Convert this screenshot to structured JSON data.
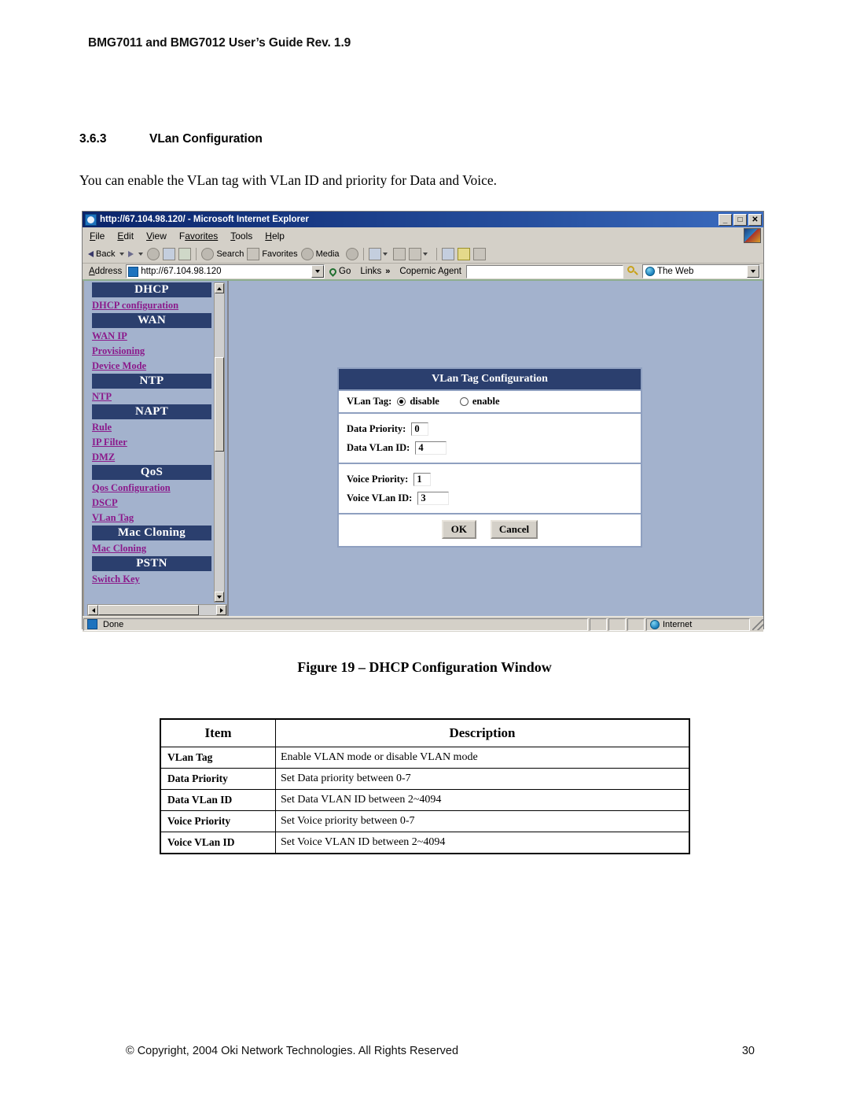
{
  "document": {
    "header": "BMG7011 and BMG7012 User’s Guide Rev. 1.9",
    "section_number": "3.6.3",
    "section_title": "VLan Configuration",
    "intro_paragraph": "You can enable the VLan tag with VLan ID and priority for Data and Voice.",
    "figure_caption": "Figure 19 – DHCP Configuration Window",
    "footer_copyright": "© Copyright, 2004 Oki Network Technologies. All Rights Reserved",
    "page_number": "30"
  },
  "browser": {
    "title": "http://67.104.98.120/ - Microsoft Internet Explorer",
    "window_buttons": {
      "minimize": "_",
      "maximize": "□",
      "close": "✕"
    },
    "menu": [
      {
        "label": "File",
        "accel": "F",
        "rest": "ile"
      },
      {
        "label": "Edit",
        "accel": "E",
        "rest": "dit"
      },
      {
        "label": "View",
        "accel": "V",
        "rest": "iew"
      },
      {
        "label": "Favorites",
        "accel": "F",
        "rest": "avorites"
      },
      {
        "label": "Tools",
        "accel": "T",
        "rest": "ools"
      },
      {
        "label": "Help",
        "accel": "H",
        "rest": "elp"
      }
    ],
    "toolbar": {
      "back": "Back",
      "search": "Search",
      "favorites": "Favorites",
      "media": "Media"
    },
    "address": {
      "label_accel": "A",
      "label_rest": "ddress",
      "value": "http://67.104.98.120",
      "go": "Go",
      "links": "Links",
      "links_chevron": "»",
      "copernic_label": "Copernic Agent",
      "copernic_value": "",
      "web_scope": "The Web"
    },
    "status": {
      "message": "Done",
      "zone": "Internet"
    }
  },
  "nav": {
    "groups": [
      {
        "header": "DHCP",
        "links": [
          "DHCP configuration"
        ]
      },
      {
        "header": "WAN",
        "links": [
          "WAN IP",
          "Provisioning",
          "Device Mode"
        ]
      },
      {
        "header": "NTP",
        "links": [
          "NTP"
        ]
      },
      {
        "header": "NAPT",
        "links": [
          "Rule",
          "IP Filter",
          "DMZ"
        ]
      },
      {
        "header": "QoS",
        "links": [
          "Qos Configuration",
          "DSCP",
          "VLan Tag"
        ]
      },
      {
        "header": "Mac Cloning",
        "links": [
          "Mac Cloning"
        ]
      },
      {
        "header": "PSTN",
        "links": [
          "Switch Key"
        ]
      }
    ]
  },
  "form": {
    "title": "VLan Tag Configuration",
    "vlan_tag_label": "VLan Tag:",
    "radio_disable": "disable",
    "radio_enable": "enable",
    "radio_selected": "disable",
    "data_priority_label": "Data Priority:",
    "data_priority_value": "0",
    "data_vlan_id_label": "Data VLan ID:",
    "data_vlan_id_value": "4",
    "voice_priority_label": "Voice Priority:",
    "voice_priority_value": "1",
    "voice_vlan_id_label": "Voice VLan ID:",
    "voice_vlan_id_value": "3",
    "ok_label": "OK",
    "cancel_label": "Cancel"
  },
  "table": {
    "headers": [
      "Item",
      "Description"
    ],
    "rows": [
      {
        "item": "VLan Tag",
        "desc": "Enable VLAN mode or disable VLAN mode"
      },
      {
        "item": "Data Priority",
        "desc": "Set Data priority between 0-7"
      },
      {
        "item": "Data VLan ID",
        "desc": "Set Data VLAN ID between 2~4094"
      },
      {
        "item": "Voice Priority",
        "desc": "Set Voice priority between 0-7"
      },
      {
        "item": "Voice VLan ID",
        "desc": "Set Voice VLAN ID between 2~4094"
      }
    ]
  },
  "colors": {
    "nav_header_bg": "#2b3f6e",
    "nav_link": "#8b1a8b",
    "page_bg": "#a3b2cd",
    "chrome_bg": "#d4d0c8",
    "titlebar": "#0a246a"
  }
}
